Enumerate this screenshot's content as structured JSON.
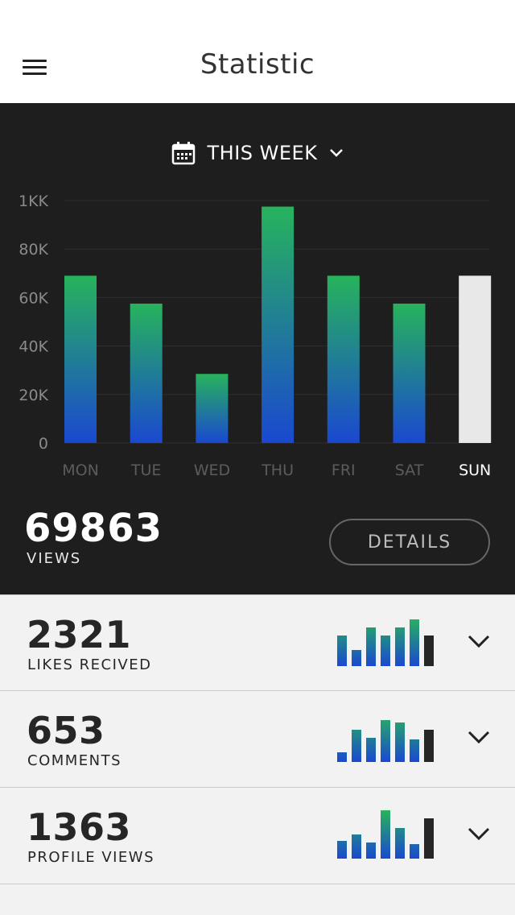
{
  "header": {
    "title": "Statistic"
  },
  "period": {
    "label": "THIS WEEK"
  },
  "colors": {
    "bar_top": "#27b35c",
    "bar_bottom": "#1a48d0",
    "bar_selected": "#e8e8e8",
    "panel_bg": "#1e1e1e",
    "mini_current": "#262626"
  },
  "chart_data": {
    "type": "bar",
    "categories": [
      "MON",
      "TUE",
      "WED",
      "THU",
      "FRI",
      "SAT",
      "SUN"
    ],
    "values": [
      69000,
      57500,
      28500,
      97500,
      69000,
      57500,
      69000
    ],
    "selected_index": 6,
    "ytick_labels": [
      "0",
      "20K",
      "40K",
      "60K",
      "80K",
      "1KK"
    ],
    "ytick_values": [
      0,
      20000,
      40000,
      60000,
      80000,
      100000
    ],
    "ylim": [
      0,
      100000
    ],
    "grid": true
  },
  "summary": {
    "value": "69863",
    "label": "VIEWS",
    "details_label": "DETAILS"
  },
  "stats": [
    {
      "value": "2321",
      "label": "LIKES RECIVED",
      "mini": [
        0.76,
        0.4,
        0.96,
        0.76,
        0.96,
        1.16,
        0.76
      ]
    },
    {
      "value": "653",
      "label": "COMMENTS",
      "mini": [
        0.24,
        0.8,
        0.6,
        1.04,
        0.98,
        0.56,
        0.8
      ]
    },
    {
      "value": "1363",
      "label": "PROFILE VIEWS",
      "mini": [
        0.44,
        0.6,
        0.4,
        1.2,
        0.76,
        0.36,
        1.0
      ]
    }
  ]
}
